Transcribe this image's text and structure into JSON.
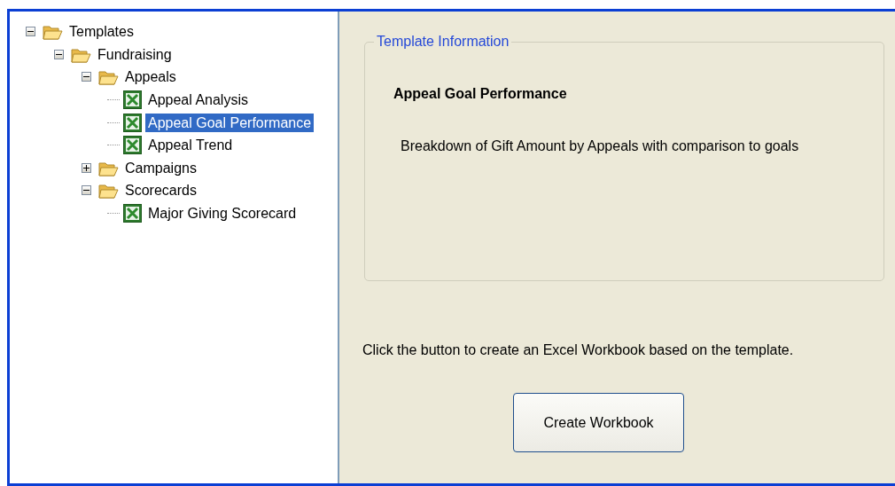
{
  "tree": [
    {
      "kind": "folder",
      "label": "Templates",
      "expanded": true,
      "selected": false,
      "children": [
        {
          "kind": "folder",
          "label": "Fundraising",
          "expanded": true,
          "selected": false,
          "children": [
            {
              "kind": "folder",
              "label": "Appeals",
              "expanded": true,
              "selected": false,
              "children": [
                {
                  "kind": "file",
                  "label": "Appeal Analysis",
                  "selected": false
                },
                {
                  "kind": "file",
                  "label": "Appeal Goal Performance",
                  "selected": true
                },
                {
                  "kind": "file",
                  "label": "Appeal Trend",
                  "selected": false
                }
              ]
            },
            {
              "kind": "folder",
              "label": "Campaigns",
              "expanded": false,
              "selected": false
            },
            {
              "kind": "folder",
              "label": "Scorecards",
              "expanded": true,
              "selected": false,
              "children": [
                {
                  "kind": "file",
                  "label": "Major Giving Scorecard",
                  "selected": false
                }
              ]
            }
          ]
        }
      ]
    }
  ],
  "info": {
    "legend": "Template Information",
    "title": "Appeal Goal Performance",
    "description": "Breakdown of Gift Amount by Appeals with comparison to goals"
  },
  "instruction": "Click the button to create an Excel Workbook based on the template.",
  "button": "Create Workbook"
}
